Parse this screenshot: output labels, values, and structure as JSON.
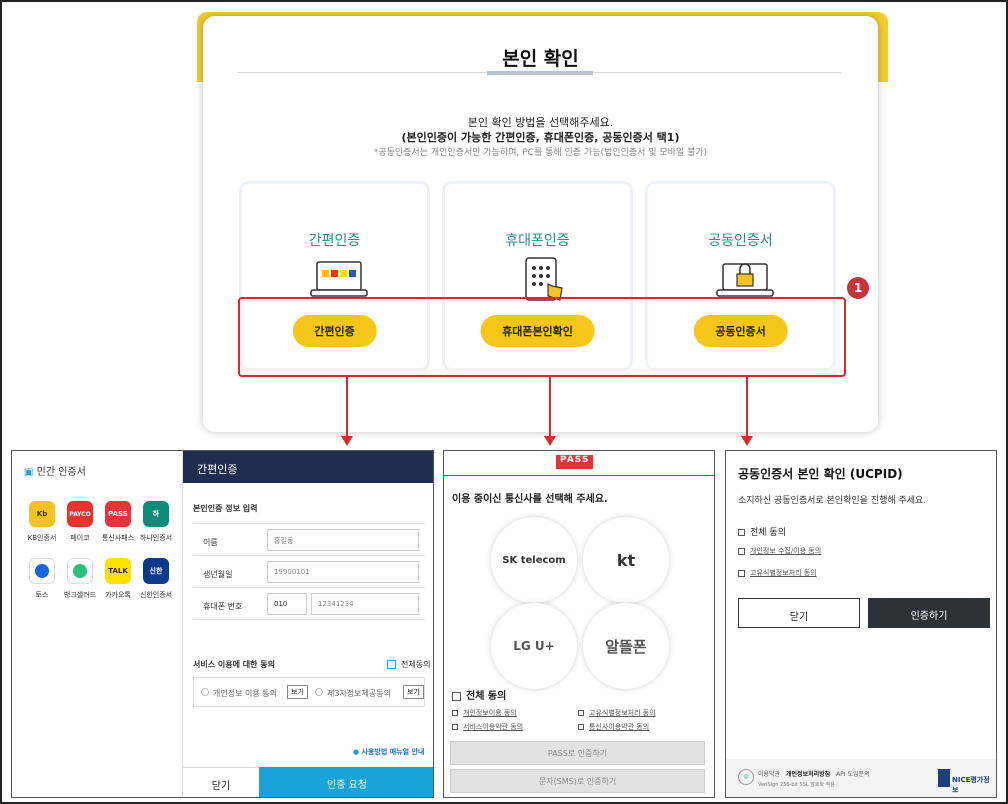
{
  "main": {
    "title": "본인 확인",
    "desc1": "본인 확인 방법을 선택해주세요.",
    "desc2": "(본인인증이 가능한 간편인증, 휴대폰인증, 공동인증서 택1)",
    "note": "*공동인증서는 개인인증서만 가능하며, PC를 통해 인증 가능(법인인증서 및 모바일 불가)",
    "methods": [
      {
        "title": "간편인증",
        "button": "간편인증",
        "icon": "laptop-apps-icon"
      },
      {
        "title": "휴대폰인증",
        "button": "휴대폰본인확인",
        "icon": "keypad-hand-icon"
      },
      {
        "title": "공동인증서",
        "button": "공동인증서",
        "icon": "laptop-lock-icon"
      }
    ],
    "badge": "1"
  },
  "panel1": {
    "header": "민간 인증서",
    "apps": [
      {
        "label": "KB인증서",
        "glyph": "Kb",
        "color": "#f5c223"
      },
      {
        "label": "페이코",
        "glyph": "PAYCO",
        "color": "#e8322c"
      },
      {
        "label": "통신사패스",
        "glyph": "PASS",
        "color": "#e8323c"
      },
      {
        "label": "하나인증서",
        "glyph": "하",
        "color": "#0e8b78"
      },
      {
        "label": "토스",
        "glyph": "",
        "color": "#ffffff"
      },
      {
        "label": "뱅크샐러드",
        "glyph": "",
        "color": "#ffffff"
      },
      {
        "label": "카카오톡",
        "glyph": "TALK",
        "color": "#fae100"
      },
      {
        "label": "신한인증서",
        "glyph": "신한",
        "color": "#0a3a8c"
      }
    ],
    "tab": "간편인증",
    "section": "본인인증 정보 입력",
    "name_label": "이름",
    "name_value": "홍길동",
    "birth_label": "생년월일",
    "birth_value": "19900101",
    "phone_label": "휴대폰 번호",
    "phone_prefix": "010",
    "phone_value": "12341234",
    "consent_title": "서비스 이용에 대한 동의",
    "agree_all": "전체동의",
    "consent1": "개인정보 이용 동의",
    "consent2": "제3자정보제공동의",
    "view": "보기",
    "manual": "사용방법 매뉴얼 안내",
    "close": "닫기",
    "request": "인증 요청"
  },
  "panel2": {
    "logo": "PASS",
    "prompt": "이용 중이신 통신사를 선택해 주세요.",
    "carriers": [
      "SK telecom",
      "kt",
      "LG U+",
      "알뜰폰"
    ],
    "agree_all": "전체 동의",
    "terms": [
      "개인정보이용 동의",
      "고유식별정보처리 동의",
      "서비스이용약관 동의",
      "통신사이용약관 동의"
    ],
    "pass_btn": "PASS로 인증하기",
    "sms_btn": "문자(SMS)로 인증하기"
  },
  "panel3": {
    "title": "공동인증서 본인 확인 (UCPID)",
    "subtitle": "소지하신 공동인증서로 본인확인을 진행해 주세요.",
    "agree_all": "전체 동의",
    "term1": "개인정보 수집/이용 동의",
    "term2": "고유식별정보처리 동의",
    "close": "닫기",
    "confirm": "인증하기",
    "footer1": "이용약관",
    "footer2": "개인정보처리방침",
    "footer3": "API 도입문의",
    "footer4": "VeriSign 256-bit SSL 암호화 적용",
    "nice": "NICE평가정보"
  }
}
